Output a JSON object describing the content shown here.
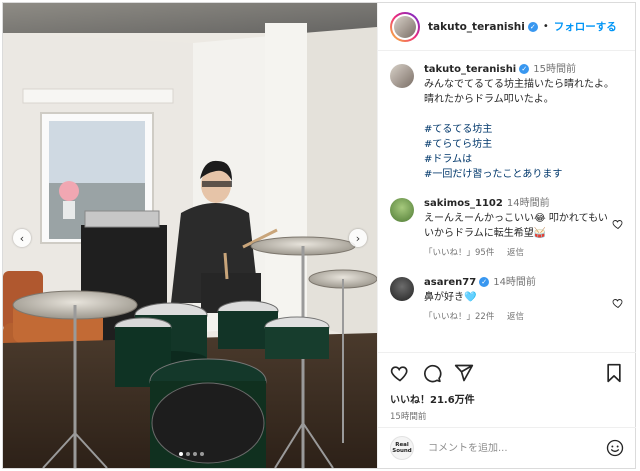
{
  "post": {
    "username": "takuto_teranishi",
    "follow_label": "フォローする",
    "separator": "•",
    "caption_time": "15時間前",
    "caption_lines": [
      "みんなでてるてる坊主描いたら晴れたよ。",
      "晴れたからドラム叩いたよ。"
    ],
    "hashtags": [
      "#てるてる坊主",
      "#てらてら坊主",
      "#ドラムは",
      "#一回だけ習ったことあります"
    ]
  },
  "comments": [
    {
      "username": "sakimos_1102",
      "time": "14時間前",
      "text": "えーんえーんかっこいい😂 叩かれてもいいからドラムに転生希望🥁",
      "likes_label": "「いいね！」95件",
      "reply_label": "返信"
    },
    {
      "username": "asaren77",
      "time": "14時間前",
      "text": "鼻が好き🩵",
      "likes_label": "「いいね！」22件",
      "reply_label": "返信"
    }
  ],
  "actions": {
    "likes_text": "いいね！21.6万件",
    "post_time": "15時間前"
  },
  "composer": {
    "placeholder": "コメントを追加...",
    "logo_text": "Real Sound"
  },
  "carousel": {
    "prev_icon": "‹",
    "next_icon": "›",
    "slide_count": 4,
    "active_slide": 1
  },
  "icons": [
    "chevron-left-icon",
    "chevron-right-icon",
    "verified-icon",
    "heart-icon",
    "comment-icon",
    "share-icon",
    "bookmark-icon",
    "emoji-icon"
  ],
  "colors": {
    "link_blue": "#0095f6",
    "hashtag": "#00376b",
    "secondary_text": "#737373",
    "verified": "#3897f0"
  }
}
